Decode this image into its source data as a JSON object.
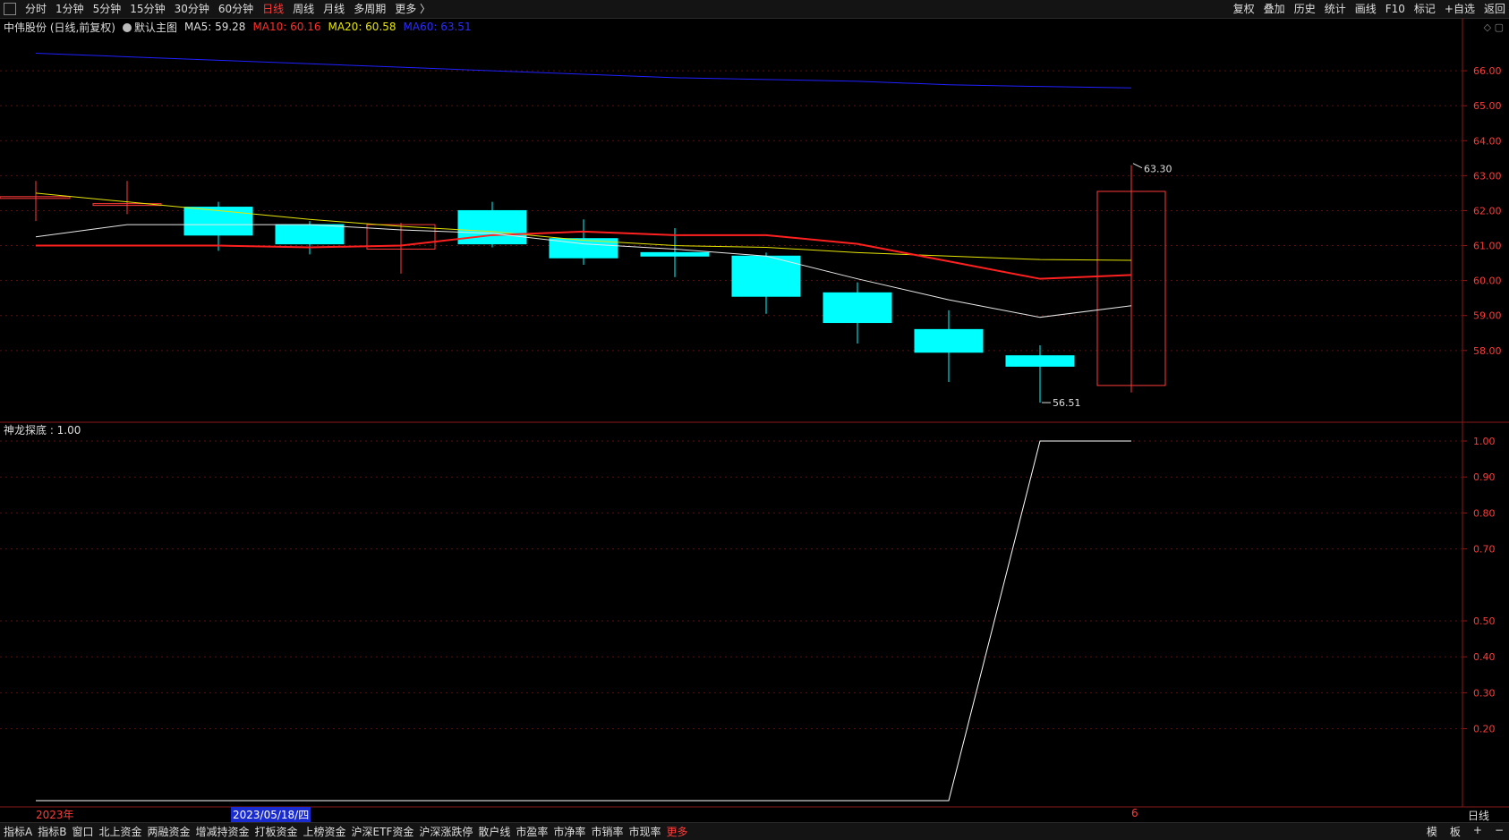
{
  "topbar": {
    "periods": [
      "分时",
      "1分钟",
      "5分钟",
      "15分钟",
      "30分钟",
      "60分钟",
      "日线",
      "周线",
      "月线",
      "多周期",
      "更多 〉"
    ],
    "active_period": "日线",
    "right_actions": [
      "复权",
      "叠加",
      "历史",
      "统计",
      "画线",
      "F10",
      "标记",
      "+自选",
      "返回"
    ]
  },
  "chart_header": {
    "title": "中伟股份 (日线,前复权)",
    "template": "默认主图",
    "ma5": "MA5: 59.28",
    "ma10": "MA10: 60.16",
    "ma20": "MA20: 60.58",
    "ma60": "MA60: 63.51"
  },
  "indicator_header": {
    "label": "神龙探底 : 1.00"
  },
  "annotations": {
    "high": "63.30",
    "low": "56.51"
  },
  "price_axis": [
    "66.00",
    "65.00",
    "64.00",
    "63.00",
    "62.00",
    "61.00",
    "60.00",
    "59.00",
    "58.00"
  ],
  "ind_axis": [
    "1.00",
    "0.90",
    "0.80",
    "0.70",
    "0.50",
    "0.40",
    "0.30",
    "0.20"
  ],
  "bottom": {
    "year_label": "2023年",
    "date_label": "2023/05/18/四",
    "cursor_label": "6",
    "period_label": "日线"
  },
  "bottombar": {
    "items": [
      "指标A",
      "指标B",
      "窗口",
      "北上资金",
      "两融资金",
      "增减持资金",
      "打板资金",
      "上榜资金",
      "沪深ETF资金",
      "沪深涨跌停",
      "散户线",
      "市盈率",
      "市净率",
      "市销率",
      "市现率",
      "更多"
    ],
    "right": [
      "模",
      "板",
      "+",
      "−"
    ]
  },
  "chart_data": {
    "type": "candlestick",
    "y_range": [
      56.0,
      67.0
    ],
    "candles": [
      {
        "o": 62.4,
        "c": 62.4,
        "h": 62.85,
        "l": 61.7
      },
      {
        "o": 62.2,
        "c": 62.2,
        "h": 62.85,
        "l": 61.9
      },
      {
        "o": 62.1,
        "c": 61.3,
        "h": 62.25,
        "l": 60.85
      },
      {
        "o": 61.6,
        "c": 61.05,
        "h": 61.7,
        "l": 60.75
      },
      {
        "o": 60.9,
        "c": 61.6,
        "h": 61.65,
        "l": 60.2
      },
      {
        "o": 62.0,
        "c": 61.05,
        "h": 62.25,
        "l": 60.95
      },
      {
        "o": 61.2,
        "c": 60.65,
        "h": 61.75,
        "l": 60.45
      },
      {
        "o": 60.8,
        "c": 60.7,
        "h": 61.5,
        "l": 60.1
      },
      {
        "o": 60.7,
        "c": 59.55,
        "h": 60.8,
        "l": 59.05
      },
      {
        "o": 59.65,
        "c": 58.8,
        "h": 59.95,
        "l": 58.2
      },
      {
        "o": 58.6,
        "c": 57.95,
        "h": 59.15,
        "l": 57.1
      },
      {
        "o": 57.85,
        "c": 57.55,
        "h": 58.15,
        "l": 56.51
      },
      {
        "o": 57.0,
        "c": 62.55,
        "h": 63.3,
        "l": 56.8
      }
    ],
    "ma5": [
      61.25,
      61.6,
      61.6,
      61.6,
      61.45,
      61.35,
      61.05,
      60.9,
      60.7,
      60.05,
      59.45,
      58.95,
      59.28
    ],
    "ma10": [
      61.0,
      61.0,
      61.0,
      60.95,
      61.0,
      61.3,
      61.4,
      61.3,
      61.3,
      61.05,
      60.55,
      60.05,
      60.16
    ],
    "ma20": [
      62.5,
      62.25,
      62.0,
      61.75,
      61.55,
      61.4,
      61.15,
      61.0,
      60.95,
      60.8,
      60.7,
      60.6,
      60.58
    ],
    "ma60": [
      66.5,
      66.4,
      66.3,
      66.2,
      66.1,
      66.0,
      65.9,
      65.8,
      65.75,
      65.7,
      65.6,
      65.55,
      65.51
    ],
    "indicator": [
      0,
      0,
      0,
      0,
      0,
      0,
      0,
      0,
      0,
      0,
      0,
      1,
      1
    ],
    "colors": {
      "down": "#00ffff",
      "up": "#ff3b3b",
      "ma5": "#e8e8e8",
      "ma10": "#ff2020",
      "ma20": "#e6e600",
      "ma60": "#2020ff",
      "indicator": "#ffffff"
    }
  }
}
